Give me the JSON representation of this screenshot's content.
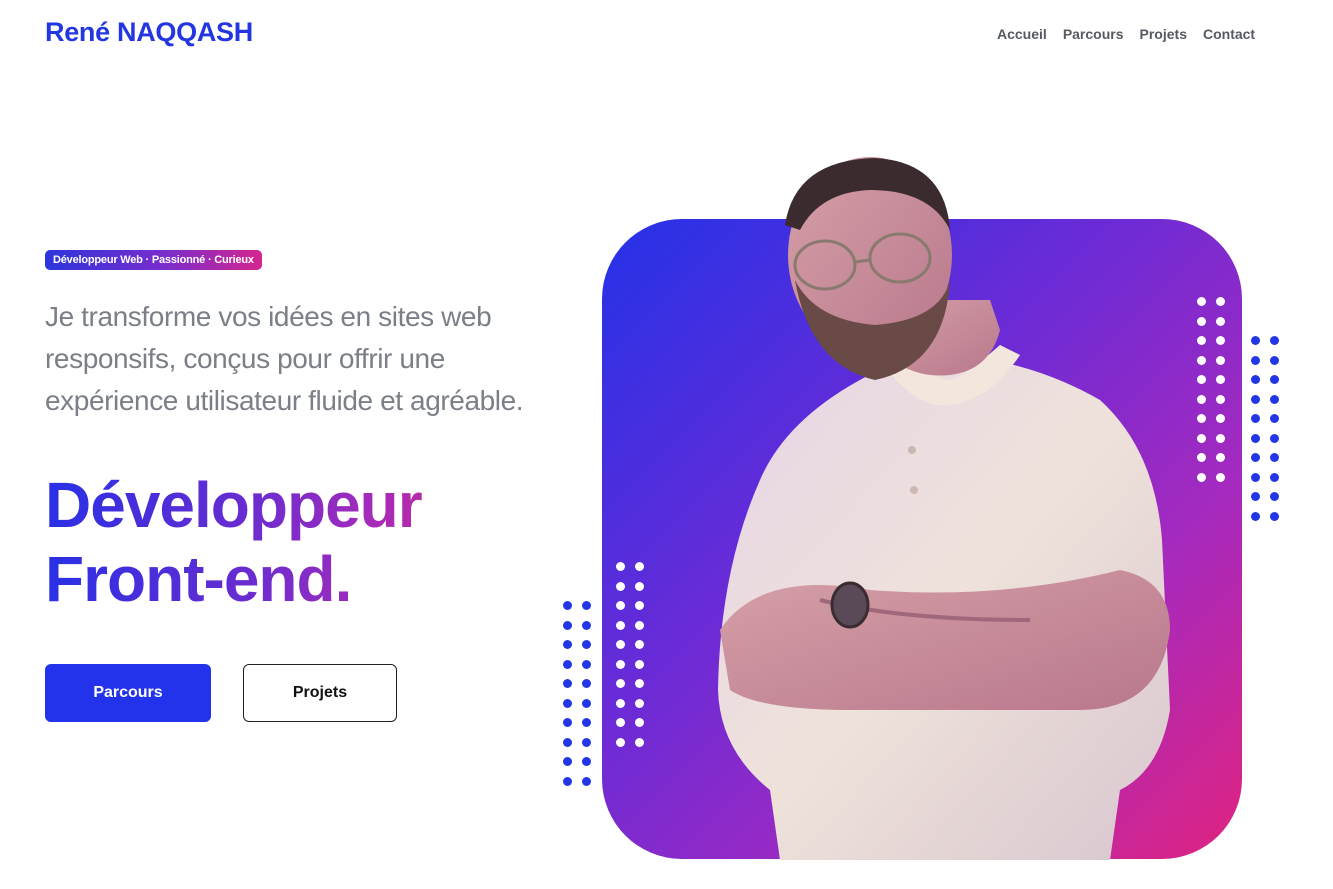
{
  "header": {
    "brand": "René NAQQASH",
    "nav": [
      "Accueil",
      "Parcours",
      "Projets",
      "Contact"
    ]
  },
  "hero": {
    "badge": "Développeur Web · Passionné · Curieux",
    "intro": "Je transforme vos idées en sites web responsifs, conçus pour offrir une expérience utilisateur fluide et agréable.",
    "headline_line1": "Développeur",
    "headline_line2": "Front-end.",
    "primary_button": "Parcours",
    "secondary_button": "Projets"
  },
  "colors": {
    "brand_blue": "#2336e0",
    "gradient_start": "#2432e8",
    "gradient_mid": "#6b2bd6",
    "gradient_end": "#e0237f",
    "nav_text": "#555a63",
    "intro_text": "#7b8088"
  },
  "images": {
    "portrait": "portrait-photo"
  }
}
